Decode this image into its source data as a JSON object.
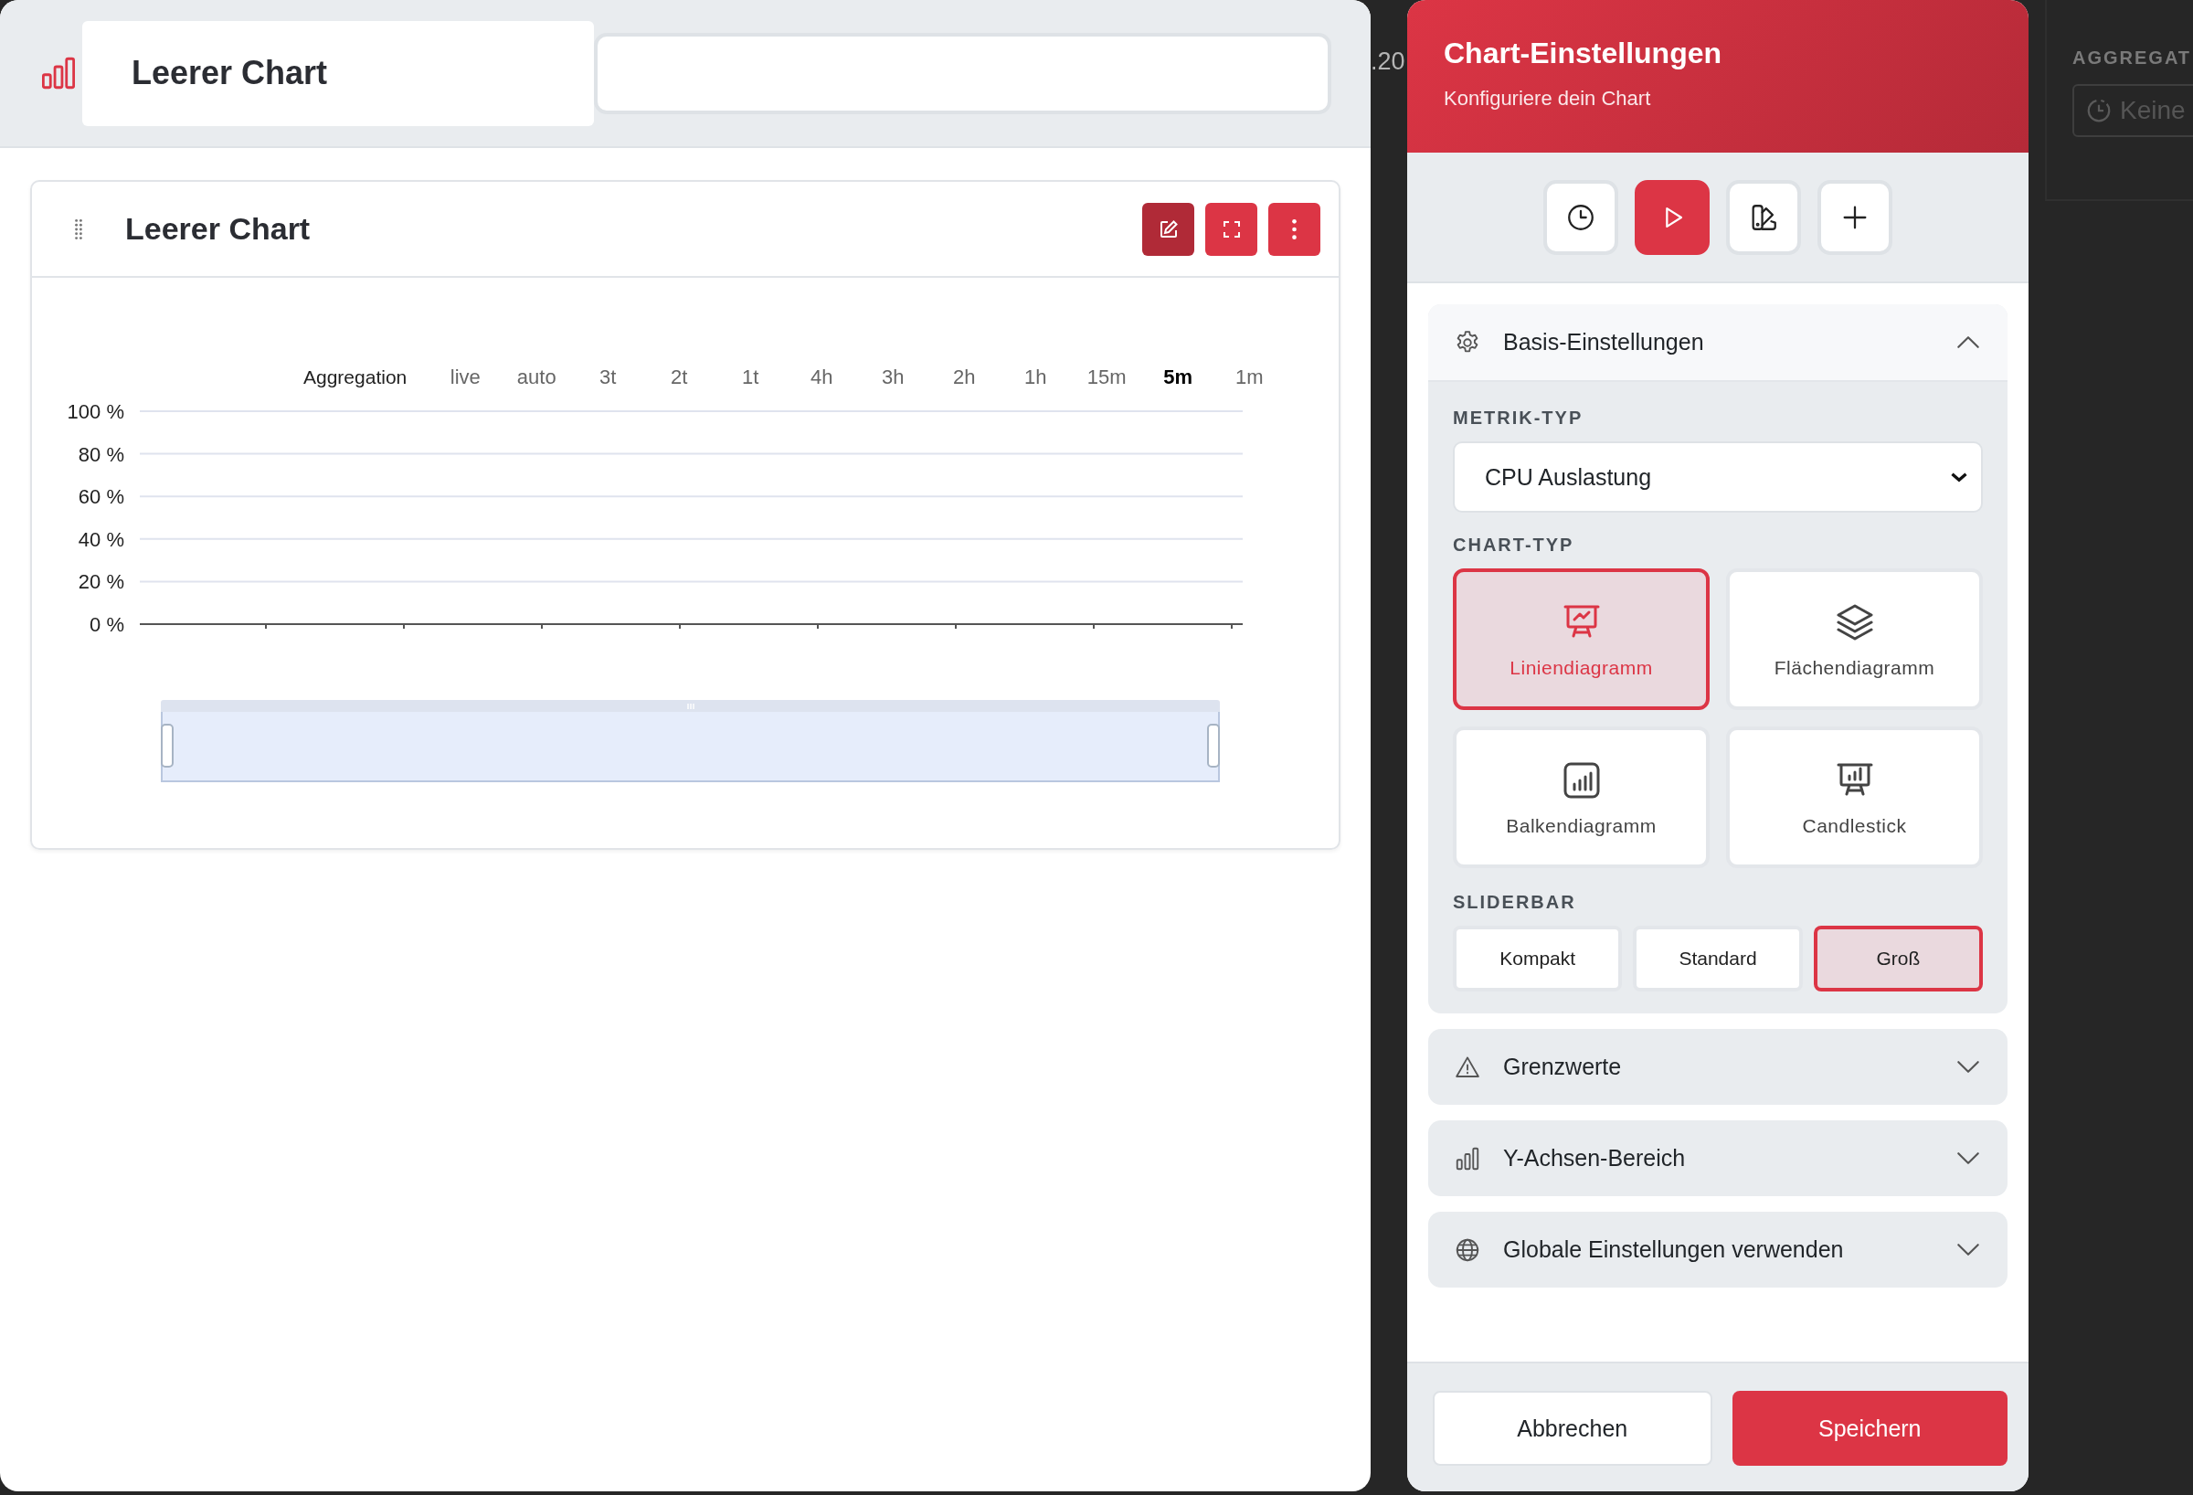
{
  "header": {
    "title": "Leerer Chart"
  },
  "widget": {
    "title": "Leerer Chart",
    "aggregation_label": "Aggregation",
    "aggregations": [
      {
        "label": "live",
        "selected": false
      },
      {
        "label": "auto",
        "selected": false
      },
      {
        "label": "3t",
        "selected": false
      },
      {
        "label": "2t",
        "selected": false
      },
      {
        "label": "1t",
        "selected": false
      },
      {
        "label": "4h",
        "selected": false
      },
      {
        "label": "3h",
        "selected": false
      },
      {
        "label": "2h",
        "selected": false
      },
      {
        "label": "1h",
        "selected": false
      },
      {
        "label": "15m",
        "selected": false
      },
      {
        "label": "5m",
        "selected": true
      },
      {
        "label": "1m",
        "selected": false
      }
    ],
    "y_axis_labels": [
      "100 %",
      "80 %",
      "60 %",
      "40 %",
      "20 %",
      "0 %"
    ],
    "slider": {
      "level": 1
    }
  },
  "background": {
    "fragment": ".20",
    "column_label": "AGGREGAT",
    "column_value": "Keine"
  },
  "settings": {
    "title": "Chart-Einstellungen",
    "subtitle": "Konfiguriere dein Chart",
    "toolbar": [
      {
        "selected": false
      },
      {
        "selected": true
      },
      {
        "selected": false
      },
      {
        "selected": false
      }
    ],
    "sections": [
      {
        "title": "Basis-Einstellungen",
        "expanded": true
      },
      {
        "title": "Grenzwerte",
        "expanded": false
      },
      {
        "title": "Y-Achsen-Bereich",
        "expanded": false
      },
      {
        "title": "Globale Einstellungen verwenden",
        "expanded": false
      }
    ],
    "basis": {
      "metric_label": "METRIK-TYP",
      "metric_value": "CPU Auslastung",
      "chart_type_label": "CHART-TYP",
      "chart_types": [
        {
          "label": "Liniendiagramm",
          "selected": true
        },
        {
          "label": "Flächendiagramm",
          "selected": false
        },
        {
          "label": "Balkendiagramm",
          "selected": false
        },
        {
          "label": "Candlestick",
          "selected": false
        }
      ],
      "sliderbar_label": "SLIDERBAR",
      "sliderbar_options": [
        {
          "label": "Kompakt",
          "selected": false
        },
        {
          "label": "Standard",
          "selected": false
        },
        {
          "label": "Groß",
          "selected": true
        }
      ]
    },
    "buttons": [
      {
        "label": "Abbrechen",
        "kind": "secondary"
      },
      {
        "label": "Speichern",
        "kind": "primary"
      }
    ]
  }
}
